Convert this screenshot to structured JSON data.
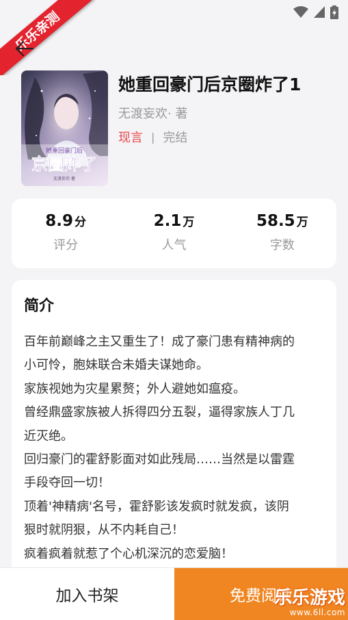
{
  "ribbon": {
    "text": "乐乐亲测"
  },
  "book": {
    "title": "她重回豪门后京圈炸了1",
    "author": "无渡妄欢· 著",
    "genre": "现言",
    "separator": "|",
    "status": "完结",
    "cover": {
      "subtitle": "她重回豪门后",
      "title": "京圈炸了",
      "author": "无渡妄欢·著"
    }
  },
  "stats": [
    {
      "value": "8.9",
      "unit": "分",
      "label": "评分"
    },
    {
      "value": "2.1",
      "unit": "万",
      "label": "人气"
    },
    {
      "value": "58.5",
      "unit": "万",
      "label": "字数"
    }
  ],
  "intro": {
    "heading": "简介",
    "lines": [
      "百年前巅峰之主又重生了！成了豪门患有精神病的",
      "小可怜，胞妹联合未婚夫谋她命。",
      "家族视她为灾星累赘；外人避她如瘟疫。",
      "曾经鼎盛家族被人拆得四分五裂，逼得家族人丁几",
      "近灭绝。",
      "回归豪门的霍舒影面对如此残局……当然是以雷霆",
      "手段夺回一切！",
      "顶着'神精病'名号，霍舒影该发疯时就发疯，该阴",
      "狠时就阴狠，从不内耗自己！",
      "疯着疯着就惹了个心机深沉的恋爱脑！"
    ]
  },
  "actions": {
    "add_shelf": "加入书架",
    "read_free": "免费阅读"
  },
  "watermark": {
    "main": "乐乐游戏",
    "url": "www.6ll.com"
  },
  "colors": {
    "accent_orange": "#f08622",
    "genre_red": "#e8474c",
    "ribbon_red": "#e3232e"
  }
}
